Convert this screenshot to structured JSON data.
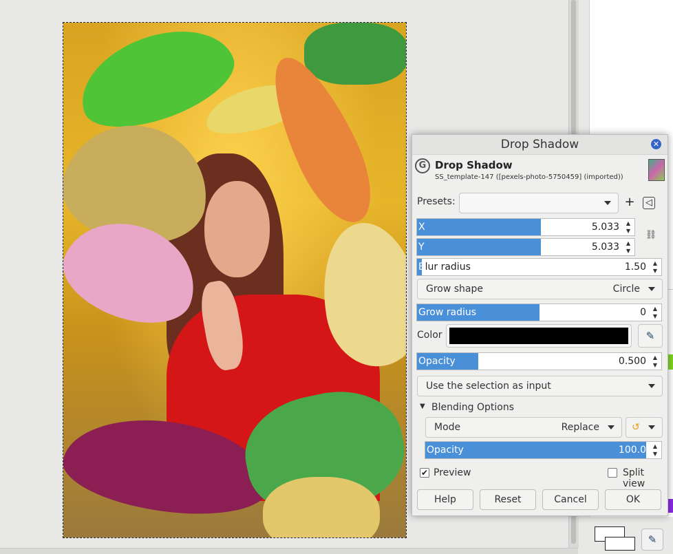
{
  "dialog": {
    "window_title": "Drop Shadow",
    "name": "Drop Shadow",
    "subtitle": "SS_template-147 ([pexels-photo-5750459] (imported))",
    "presets_label": "Presets:",
    "presets_value": "",
    "x": {
      "label": "X",
      "value": "5.033",
      "fill_fraction": 0.57
    },
    "y": {
      "label": "Y",
      "value": "5.033",
      "fill_fraction": 0.57
    },
    "blur": {
      "label_first": "B",
      "label_rest": "lur radius",
      "value": "1.50",
      "fill_fraction": 0.02
    },
    "grow_shape": {
      "label": "Grow shape",
      "value": "Circle"
    },
    "grow_radius": {
      "label": "Grow radius",
      "value": "0",
      "fill_fraction": 0.5
    },
    "color": {
      "label": "Color",
      "value": "#000000"
    },
    "opacity": {
      "label": "Opacity",
      "value": "0.500",
      "fill_fraction": 0.25
    },
    "input_mode": "Use the selection as input",
    "blending": {
      "title": "Blending Options",
      "mode_label": "Mode",
      "mode_value": "Replace",
      "opacity_label": "Opacity",
      "opacity_value": "100.0",
      "opacity_fill_fraction": 1.0
    },
    "preview_label": "Preview",
    "preview_checked": true,
    "split_view_label": "Split view",
    "split_view_checked": false,
    "buttons": {
      "help": "Help",
      "reset": "Reset",
      "cancel": "Cancel",
      "ok": "OK"
    }
  },
  "colors": {
    "accent": "#4a90d9",
    "shirt": "#d41616"
  },
  "icons": {
    "close": "close-icon",
    "logo": "gegl-logo-icon",
    "add": "plus-icon",
    "menu": "preset-menu-icon",
    "chain": "chain-link-icon",
    "picker": "eyedropper-icon",
    "reset_mode": "reset-icon"
  },
  "glyphs": {
    "close": "✕",
    "logo": "G",
    "plus": "+",
    "menu": "◁",
    "chain": "⛓",
    "eyedropper": "✎",
    "reset": "↺",
    "expander": "▼",
    "check": "✔",
    "step_up": "▲",
    "step_down": "▼"
  }
}
